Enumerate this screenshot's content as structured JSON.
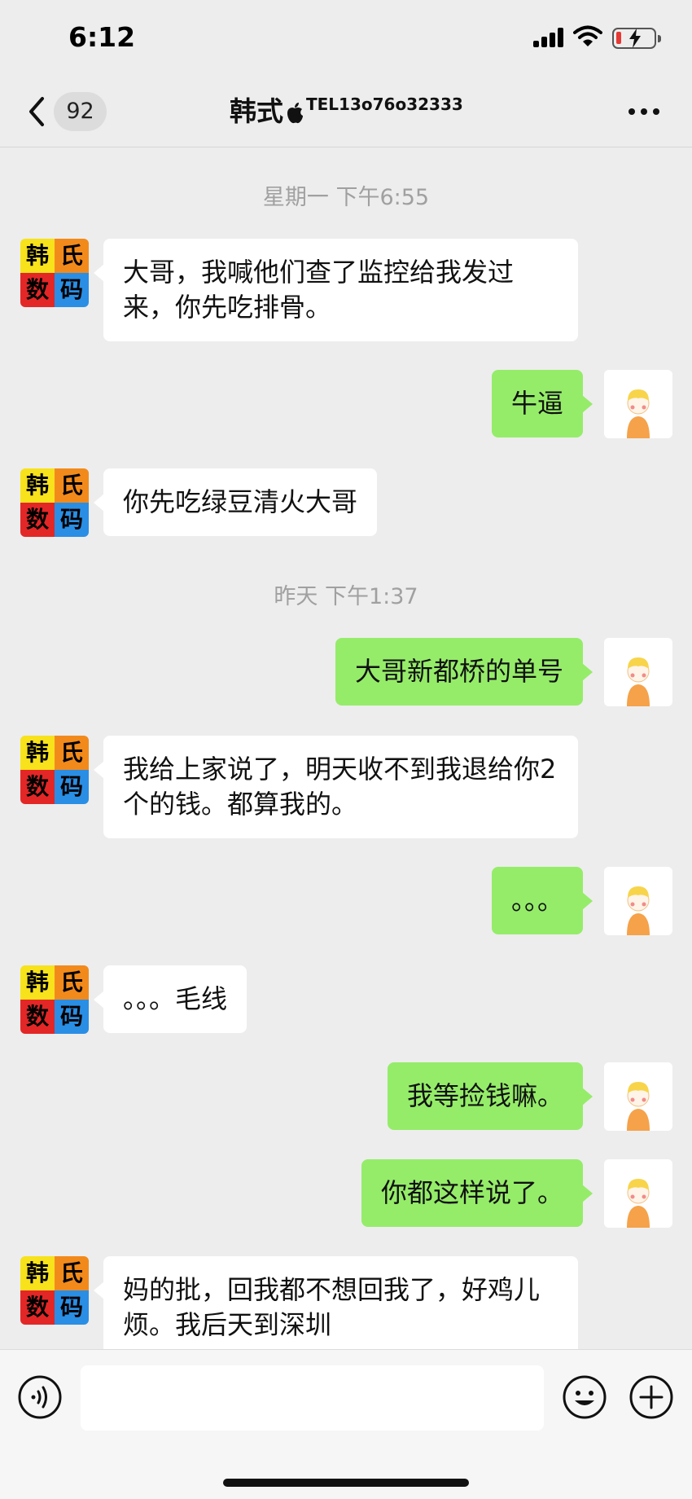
{
  "status_bar": {
    "time": "6:12"
  },
  "nav": {
    "unread_count": "92",
    "title": "韩式",
    "subtitle": "TEL13o76o32333"
  },
  "messages": [
    {
      "type": "timestamp",
      "text": "星期一 下午6:55"
    },
    {
      "type": "in",
      "text": "大哥，我喊他们查了监控给我发过来，你先吃排骨。"
    },
    {
      "type": "out",
      "text": "牛逼"
    },
    {
      "type": "in",
      "text": "你先吃绿豆清火大哥"
    },
    {
      "type": "timestamp",
      "text": "昨天 下午1:37"
    },
    {
      "type": "out",
      "text": "大哥新都桥的单号"
    },
    {
      "type": "in",
      "text": "我给上家说了，明天收不到我退给你2个的钱。都算我的。"
    },
    {
      "type": "out",
      "text": "。。。"
    },
    {
      "type": "in",
      "text": "。。。毛线"
    },
    {
      "type": "out",
      "text": "我等捡钱嘛。"
    },
    {
      "type": "out",
      "text": "你都这样说了。"
    },
    {
      "type": "in",
      "text": "妈的批，回我都不想回我了，好鸡儿烦。我后天到深圳"
    }
  ],
  "shop_avatar": {
    "chars": [
      "韩",
      "氏",
      "数",
      "码"
    ],
    "colors": [
      "#f7e21b",
      "#f28a1b",
      "#e32727",
      "#2a8ee5"
    ]
  },
  "colors": {
    "outgoing_bubble": "#95ec69",
    "incoming_bubble": "#ffffff",
    "background": "#ededed"
  },
  "input": {
    "value": "",
    "placeholder": ""
  },
  "icons": {
    "back": "chevron-left-icon",
    "more": "more-icon",
    "voice": "voice-icon",
    "emoji": "emoji-icon",
    "plus": "plus-icon"
  }
}
